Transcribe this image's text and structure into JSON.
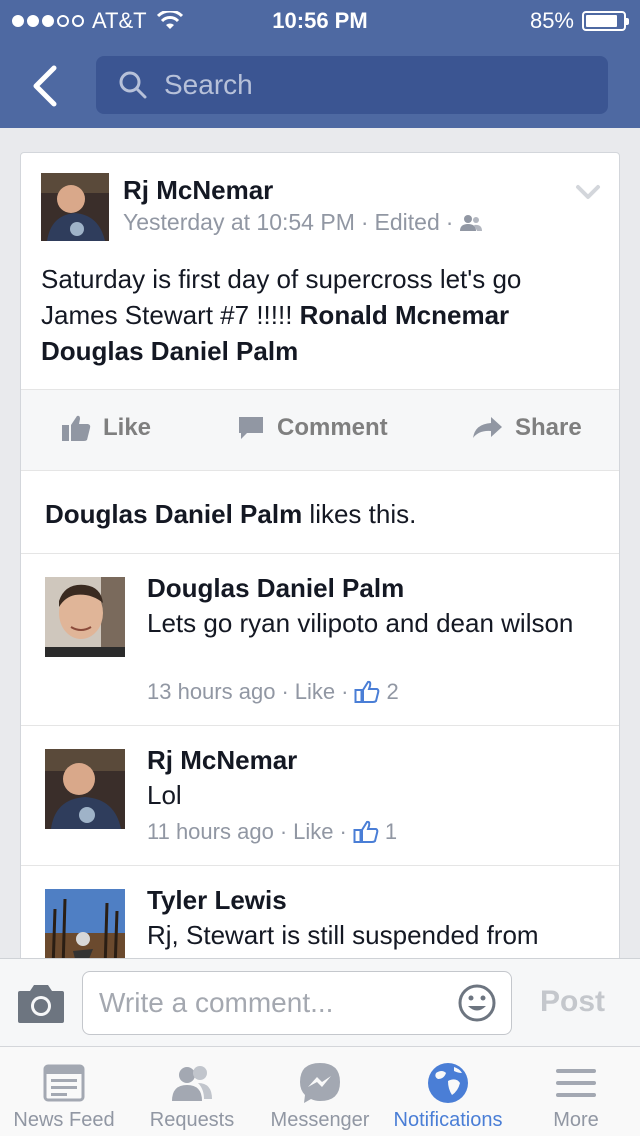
{
  "status_bar": {
    "carrier": "AT&T",
    "time": "10:56 PM",
    "battery": "85%",
    "battery_level": 0.85
  },
  "header": {
    "back_icon": "chevron-left-icon",
    "search_placeholder": "Search"
  },
  "post": {
    "author": "Rj McNemar",
    "timestamp": "Yesterday at 10:54 PM",
    "edited": "Edited",
    "separator": "·",
    "text_plain": "Saturday is first day of supercross let's go James Stewart #7 !!!!! ",
    "tag_1": "Ronald Mcnemar",
    "tag_2": "Douglas Daniel Palm"
  },
  "actions": {
    "like": "Like",
    "comment": "Comment",
    "share": "Share"
  },
  "likes": {
    "name": "Douglas Daniel Palm",
    "suffix": " likes this."
  },
  "comments": [
    {
      "name": "Douglas Daniel Palm",
      "text": "Lets go ryan vilipoto and dean wilson",
      "time": "13 hours ago",
      "like_label": "Like",
      "like_count": "2"
    },
    {
      "name": "Rj McNemar",
      "text": "Lol",
      "time": "11 hours ago",
      "like_label": "Like",
      "like_count": "1"
    },
    {
      "name": "Tyler Lewis",
      "text": "Rj, Stewart is still suspended from"
    }
  ],
  "composer": {
    "placeholder": "Write a comment...",
    "post_label": "Post"
  },
  "tabs": [
    {
      "label": "News Feed",
      "icon": "news-feed-icon"
    },
    {
      "label": "Requests",
      "icon": "requests-icon"
    },
    {
      "label": "Messenger",
      "icon": "messenger-icon"
    },
    {
      "label": "Notifications",
      "icon": "globe-icon",
      "active": true
    },
    {
      "label": "More",
      "icon": "menu-icon"
    }
  ],
  "colors": {
    "brand": "#4e69a2",
    "active_tab": "#4a7ed6"
  }
}
